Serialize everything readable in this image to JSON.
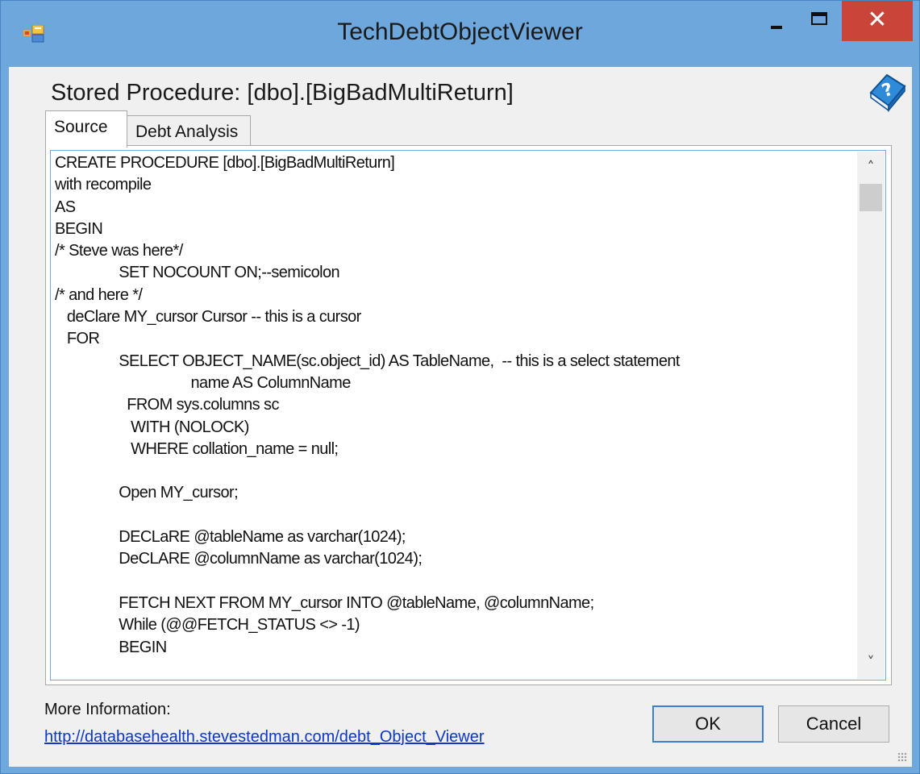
{
  "window": {
    "title": "TechDebtObjectViewer",
    "close_glyph": "✕",
    "accent_color": "#6ea7dc",
    "close_color": "#c9453a"
  },
  "header": {
    "heading": "Stored Procedure:  [dbo].[BigBadMultiReturn]"
  },
  "tabs": [
    {
      "label": "Source",
      "selected": true
    },
    {
      "label": "Debt Analysis",
      "selected": false
    }
  ],
  "source_code": "CREATE PROCEDURE [dbo].[BigBadMultiReturn]\nwith recompile\nAS\nBEGIN\n/* Steve was here*/\n                SET NOCOUNT ON;--semicolon\n/* and here */\n   deClare MY_cursor Cursor -- this is a cursor\n   FOR\n                SELECT OBJECT_NAME(sc.object_id) AS TableName,  -- this is a select statement\n                                  name AS ColumnName\n                  FROM sys.columns sc\n                   WITH (NOLOCK)\n                   WHERE collation_name = null;\n\n                Open MY_cursor;\n\n                DECLaRE @tableName as varchar(1024);\n                DeCLARE @columnName as varchar(1024);\n\n                FETCH NEXT FROM MY_cursor INTO @tableName, @columnName;\n                While (@@FETCH_STATUS <> -1)\n                BEGIN",
  "footer": {
    "more_info_label": "More Information:",
    "link_text": "http://databasehealth.stevestedman.com/debt_Object_Viewer",
    "ok_label": "OK",
    "cancel_label": "Cancel"
  },
  "scrollbar": {
    "up_glyph": "˄",
    "down_glyph": "˅"
  }
}
